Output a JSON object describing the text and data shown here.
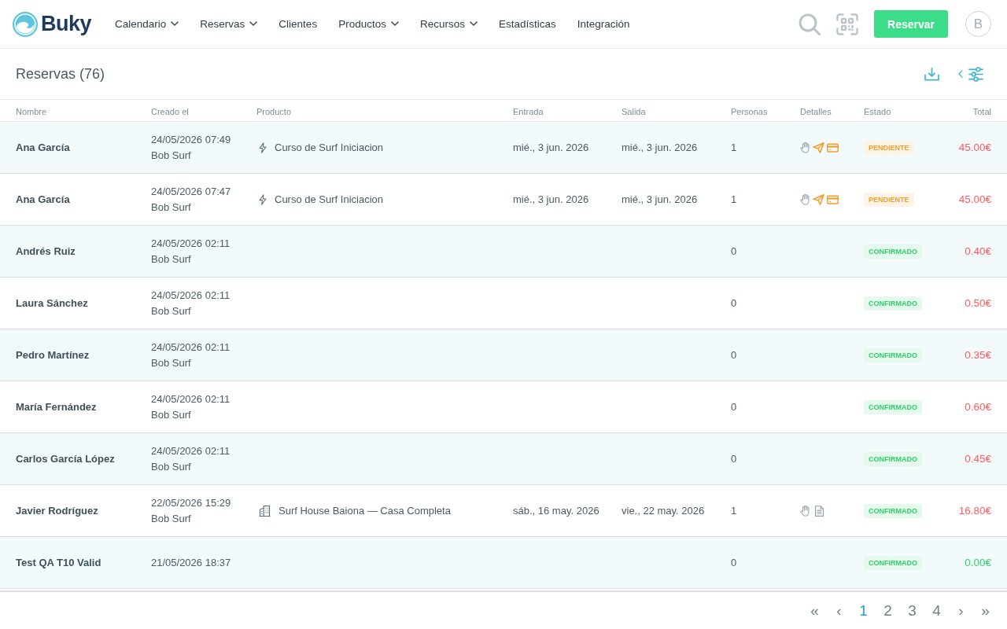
{
  "app": {
    "logo": "Buky"
  },
  "nav": [
    {
      "label": "Calendario",
      "dropdown": true
    },
    {
      "label": "Reservas",
      "dropdown": true
    },
    {
      "label": "Clientes",
      "dropdown": false
    },
    {
      "label": "Productos",
      "dropdown": true
    },
    {
      "label": "Recursos",
      "dropdown": true
    },
    {
      "label": "Estadísticas",
      "dropdown": false
    },
    {
      "label": "Integración",
      "dropdown": false
    }
  ],
  "header_actions": {
    "button": "Reservar",
    "avatar": "B"
  },
  "toolbar": {
    "title": "Reservas (76)"
  },
  "table": {
    "columns": [
      "Nombre",
      "Creado el",
      "Producto",
      "Entrada",
      "Salida",
      "Personas",
      "Detalles",
      "Estado",
      "Total"
    ],
    "rows": [
      {
        "name": "Ana García",
        "created": "24/05/2026 07:49",
        "created_by": "Bob Surf",
        "product": {
          "kind": "course",
          "name": "Curso de Surf Iniciacion"
        },
        "check_in": "mié., 3 jun. 2026",
        "check_out": "mié., 3 jun. 2026",
        "persons": "1",
        "details": [
          {
            "kind": "hand",
            "color": "#9aaab2"
          },
          {
            "kind": "send",
            "color": "#f0a030"
          },
          {
            "kind": "card",
            "color": "#f0a030"
          }
        ],
        "status": {
          "label": "PENDIENTE",
          "color": "#f0a030"
        },
        "total": {
          "amount": "45.00€",
          "color": "#ff5a5f"
        }
      },
      {
        "name": "Ana García",
        "created": "24/05/2026 07:47",
        "created_by": "Bob Surf",
        "product": {
          "kind": "course",
          "name": "Curso de Surf Iniciacion"
        },
        "check_in": "mié., 3 jun. 2026",
        "check_out": "mié., 3 jun. 2026",
        "persons": "1",
        "details": [
          {
            "kind": "hand",
            "color": "#9aaab2"
          },
          {
            "kind": "send",
            "color": "#f0a030"
          },
          {
            "kind": "card",
            "color": "#f0a030"
          }
        ],
        "status": {
          "label": "PENDIENTE",
          "color": "#f0a030"
        },
        "total": {
          "amount": "45.00€",
          "color": "#ff5a5f"
        }
      },
      {
        "name": "Andrés Ruiz",
        "created": "24/05/2026 02:11",
        "created_by": "Bob Surf",
        "persons": "0",
        "status": {
          "label": "CONFIRMADO",
          "color": "#2ecf68"
        },
        "total": {
          "amount": "0.40€",
          "color": "#ff5a5f"
        }
      },
      {
        "name": "Laura Sánchez",
        "created": "24/05/2026 02:11",
        "created_by": "Bob Surf",
        "persons": "0",
        "status": {
          "label": "CONFIRMADO",
          "color": "#2ecf68"
        },
        "total": {
          "amount": "0.50€",
          "color": "#ff5a5f"
        }
      },
      {
        "name": "Pedro Martínez",
        "created": "24/05/2026 02:11",
        "created_by": "Bob Surf",
        "persons": "0",
        "status": {
          "label": "CONFIRMADO",
          "color": "#2ecf68"
        },
        "total": {
          "amount": "0.35€",
          "color": "#ff5a5f"
        }
      },
      {
        "name": "María Fernández",
        "created": "24/05/2026 02:11",
        "created_by": "Bob Surf",
        "persons": "0",
        "status": {
          "label": "CONFIRMADO",
          "color": "#2ecf68"
        },
        "total": {
          "amount": "0.60€",
          "color": "#ff5a5f"
        }
      },
      {
        "name": "Carlos García López",
        "created": "24/05/2026 02:11",
        "created_by": "Bob Surf",
        "persons": "0",
        "status": {
          "label": "CONFIRMADO",
          "color": "#2ecf68"
        },
        "total": {
          "amount": "0.45€",
          "color": "#ff5a5f"
        }
      },
      {
        "name": "Javier Rodríguez",
        "created": "22/05/2026 15:29",
        "created_by": "Bob Surf",
        "product": {
          "kind": "house",
          "name": "Surf House Baiona — Casa Completa"
        },
        "check_in": "sáb., 16 may. 2026",
        "check_out": "vie., 22 may. 2026",
        "persons": "1",
        "details": [
          {
            "kind": "hand",
            "color": "#9aaab2"
          },
          {
            "kind": "document",
            "color": "#8fa1a9"
          }
        ],
        "status": {
          "label": "CONFIRMADO",
          "color": "#2ecf68"
        },
        "total": {
          "amount": "16.80€",
          "color": "#ff5a5f"
        }
      },
      {
        "name": "Test QA T10 Valid",
        "created": "21/05/2026 18:37",
        "persons": "0",
        "status": {
          "label": "CONFIRMADO",
          "color": "#2ecf68"
        },
        "total": {
          "amount": "0.00€",
          "color": "#35cf6c"
        }
      }
    ]
  },
  "pagination": {
    "first": "«",
    "previous": "‹",
    "pages": [
      {
        "label": "1",
        "selected": true
      },
      {
        "label": "2",
        "selected": false
      },
      {
        "label": "3",
        "selected": false
      },
      {
        "label": "4",
        "selected": false
      }
    ],
    "next": "›",
    "last": "»"
  }
}
